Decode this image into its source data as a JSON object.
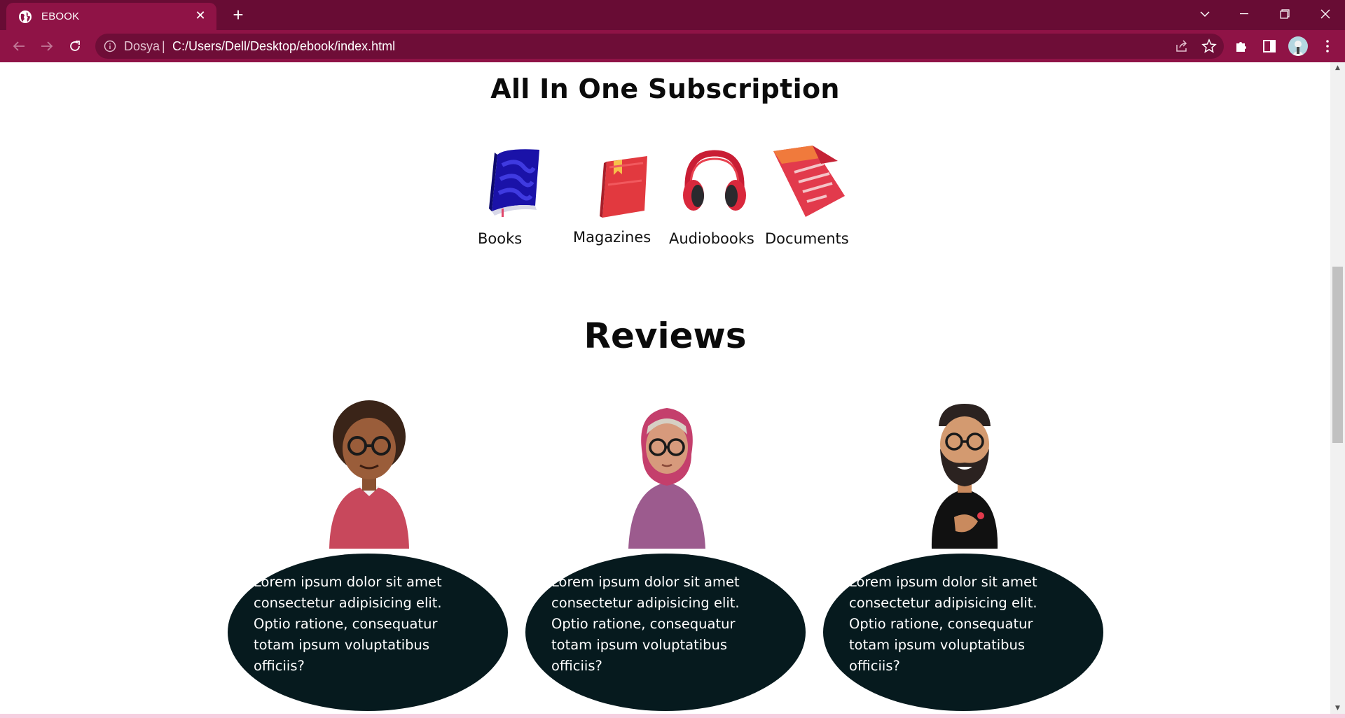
{
  "tab": {
    "title": "EBOOK",
    "close_icon": "close-icon",
    "new_tab_icon": "plus-icon"
  },
  "window_controls": [
    "chevron-down-icon",
    "minimize-icon",
    "restore-icon",
    "close-icon"
  ],
  "toolbar": {
    "origin_label": "Dosya",
    "separator": "|",
    "url": "C:/Users/Dell/Desktop/ebook/index.html"
  },
  "subscription": {
    "title": "All In One Subscription",
    "categories": [
      {
        "label": "Books",
        "icon": "book-icon"
      },
      {
        "label": "Magazines",
        "icon": "magazine-icon"
      },
      {
        "label": "Audiobooks",
        "icon": "headphones-icon"
      },
      {
        "label": "Documents",
        "icon": "document-icon"
      }
    ]
  },
  "reviews": {
    "title": "Reviews",
    "items": [
      {
        "text": "Lorem ipsum dolor sit amet consectetur adipisicing elit. Optio ratione, consequatur totam ipsum voluptatibus officiis?"
      },
      {
        "text": "Lorem ipsum dolor sit amet consectetur adipisicing elit. Optio ratione, consequatur totam ipsum voluptatibus officiis?"
      },
      {
        "text": "Lorem ipsum dolor sit amet consectetur adipisicing elit. Optio ratione, consequatur totam ipsum voluptatibus officiis?"
      }
    ]
  },
  "colors": {
    "chrome_dark": "#680c34",
    "chrome": "#8f1346",
    "bubble": "#061a1e"
  }
}
